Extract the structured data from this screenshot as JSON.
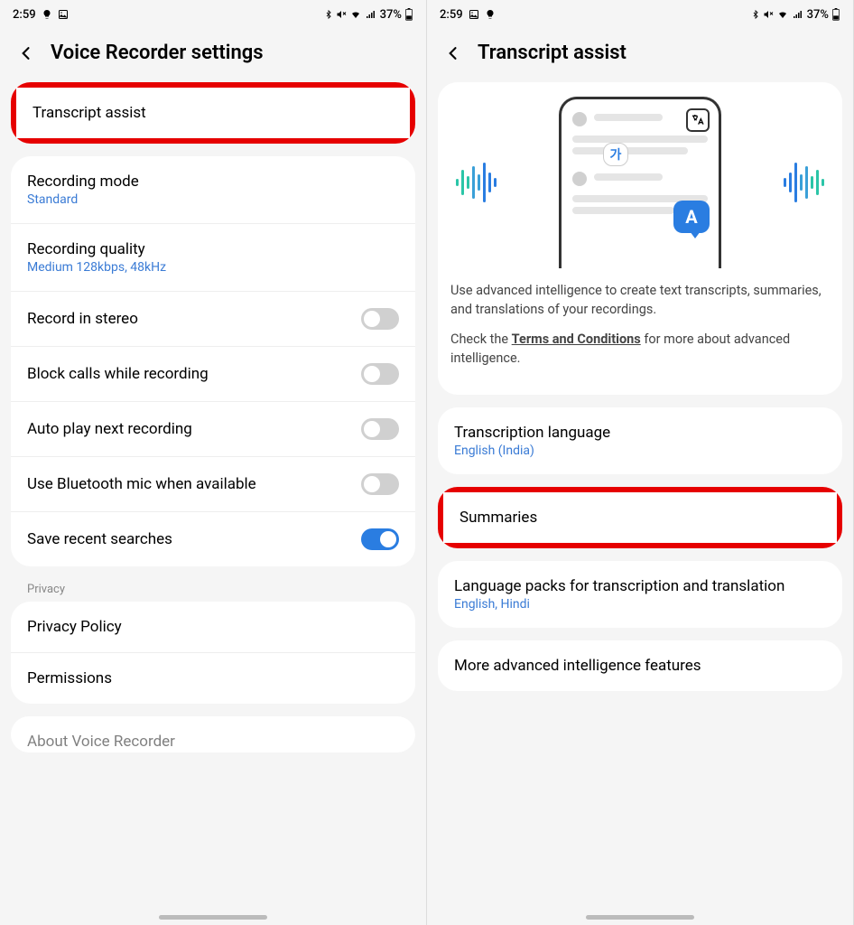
{
  "status": {
    "time": "2:59",
    "battery_text": "37%"
  },
  "left": {
    "title": "Voice Recorder settings",
    "transcript_assist": "Transcript assist",
    "recording_mode": {
      "title": "Recording mode",
      "sub": "Standard"
    },
    "recording_quality": {
      "title": "Recording quality",
      "sub": "Medium 128kbps, 48kHz"
    },
    "stereo": "Record in stereo",
    "block_calls": "Block calls while recording",
    "auto_play": "Auto play next recording",
    "bt_mic": "Use Bluetooth mic when available",
    "save_searches": "Save recent searches",
    "privacy_section": "Privacy",
    "privacy_policy": "Privacy Policy",
    "permissions": "Permissions",
    "about": "About Voice Recorder"
  },
  "right": {
    "title": "Transcript assist",
    "desc1": "Use advanced intelligence to create text transcripts, summaries, and translations of your recordings.",
    "desc2_before": "Check the ",
    "desc2_link": "Terms and Conditions",
    "desc2_after": " for more about advanced intelligence.",
    "trans_lang": {
      "title": "Transcription language",
      "sub": "English (India)"
    },
    "summaries": "Summaries",
    "lang_packs": {
      "title": "Language packs for transcription and translation",
      "sub": "English, Hindi"
    },
    "more_features": "More advanced intelligence features",
    "bubble_ka": "가",
    "bubble_a": "A"
  }
}
